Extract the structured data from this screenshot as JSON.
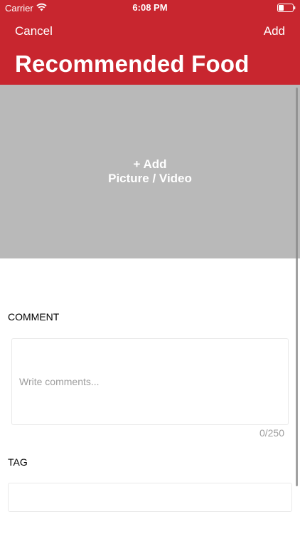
{
  "status_bar": {
    "carrier": "Carrier",
    "time": "6:08 PM",
    "wifi_icon": "wifi-icon",
    "battery_icon": "battery-icon"
  },
  "nav": {
    "cancel_label": "Cancel",
    "add_label": "Add",
    "title": "Recommended Food"
  },
  "media": {
    "line1": "+ Add",
    "line2": "Picture / Video"
  },
  "comment": {
    "label": "COMMENT",
    "placeholder": "Write comments...",
    "value": "",
    "counter": "0/250"
  },
  "tag": {
    "label": "TAG",
    "value": ""
  },
  "colors": {
    "header": "#c8262f",
    "media_background": "#b9b9b9",
    "placeholder": "#9e9e9e"
  }
}
